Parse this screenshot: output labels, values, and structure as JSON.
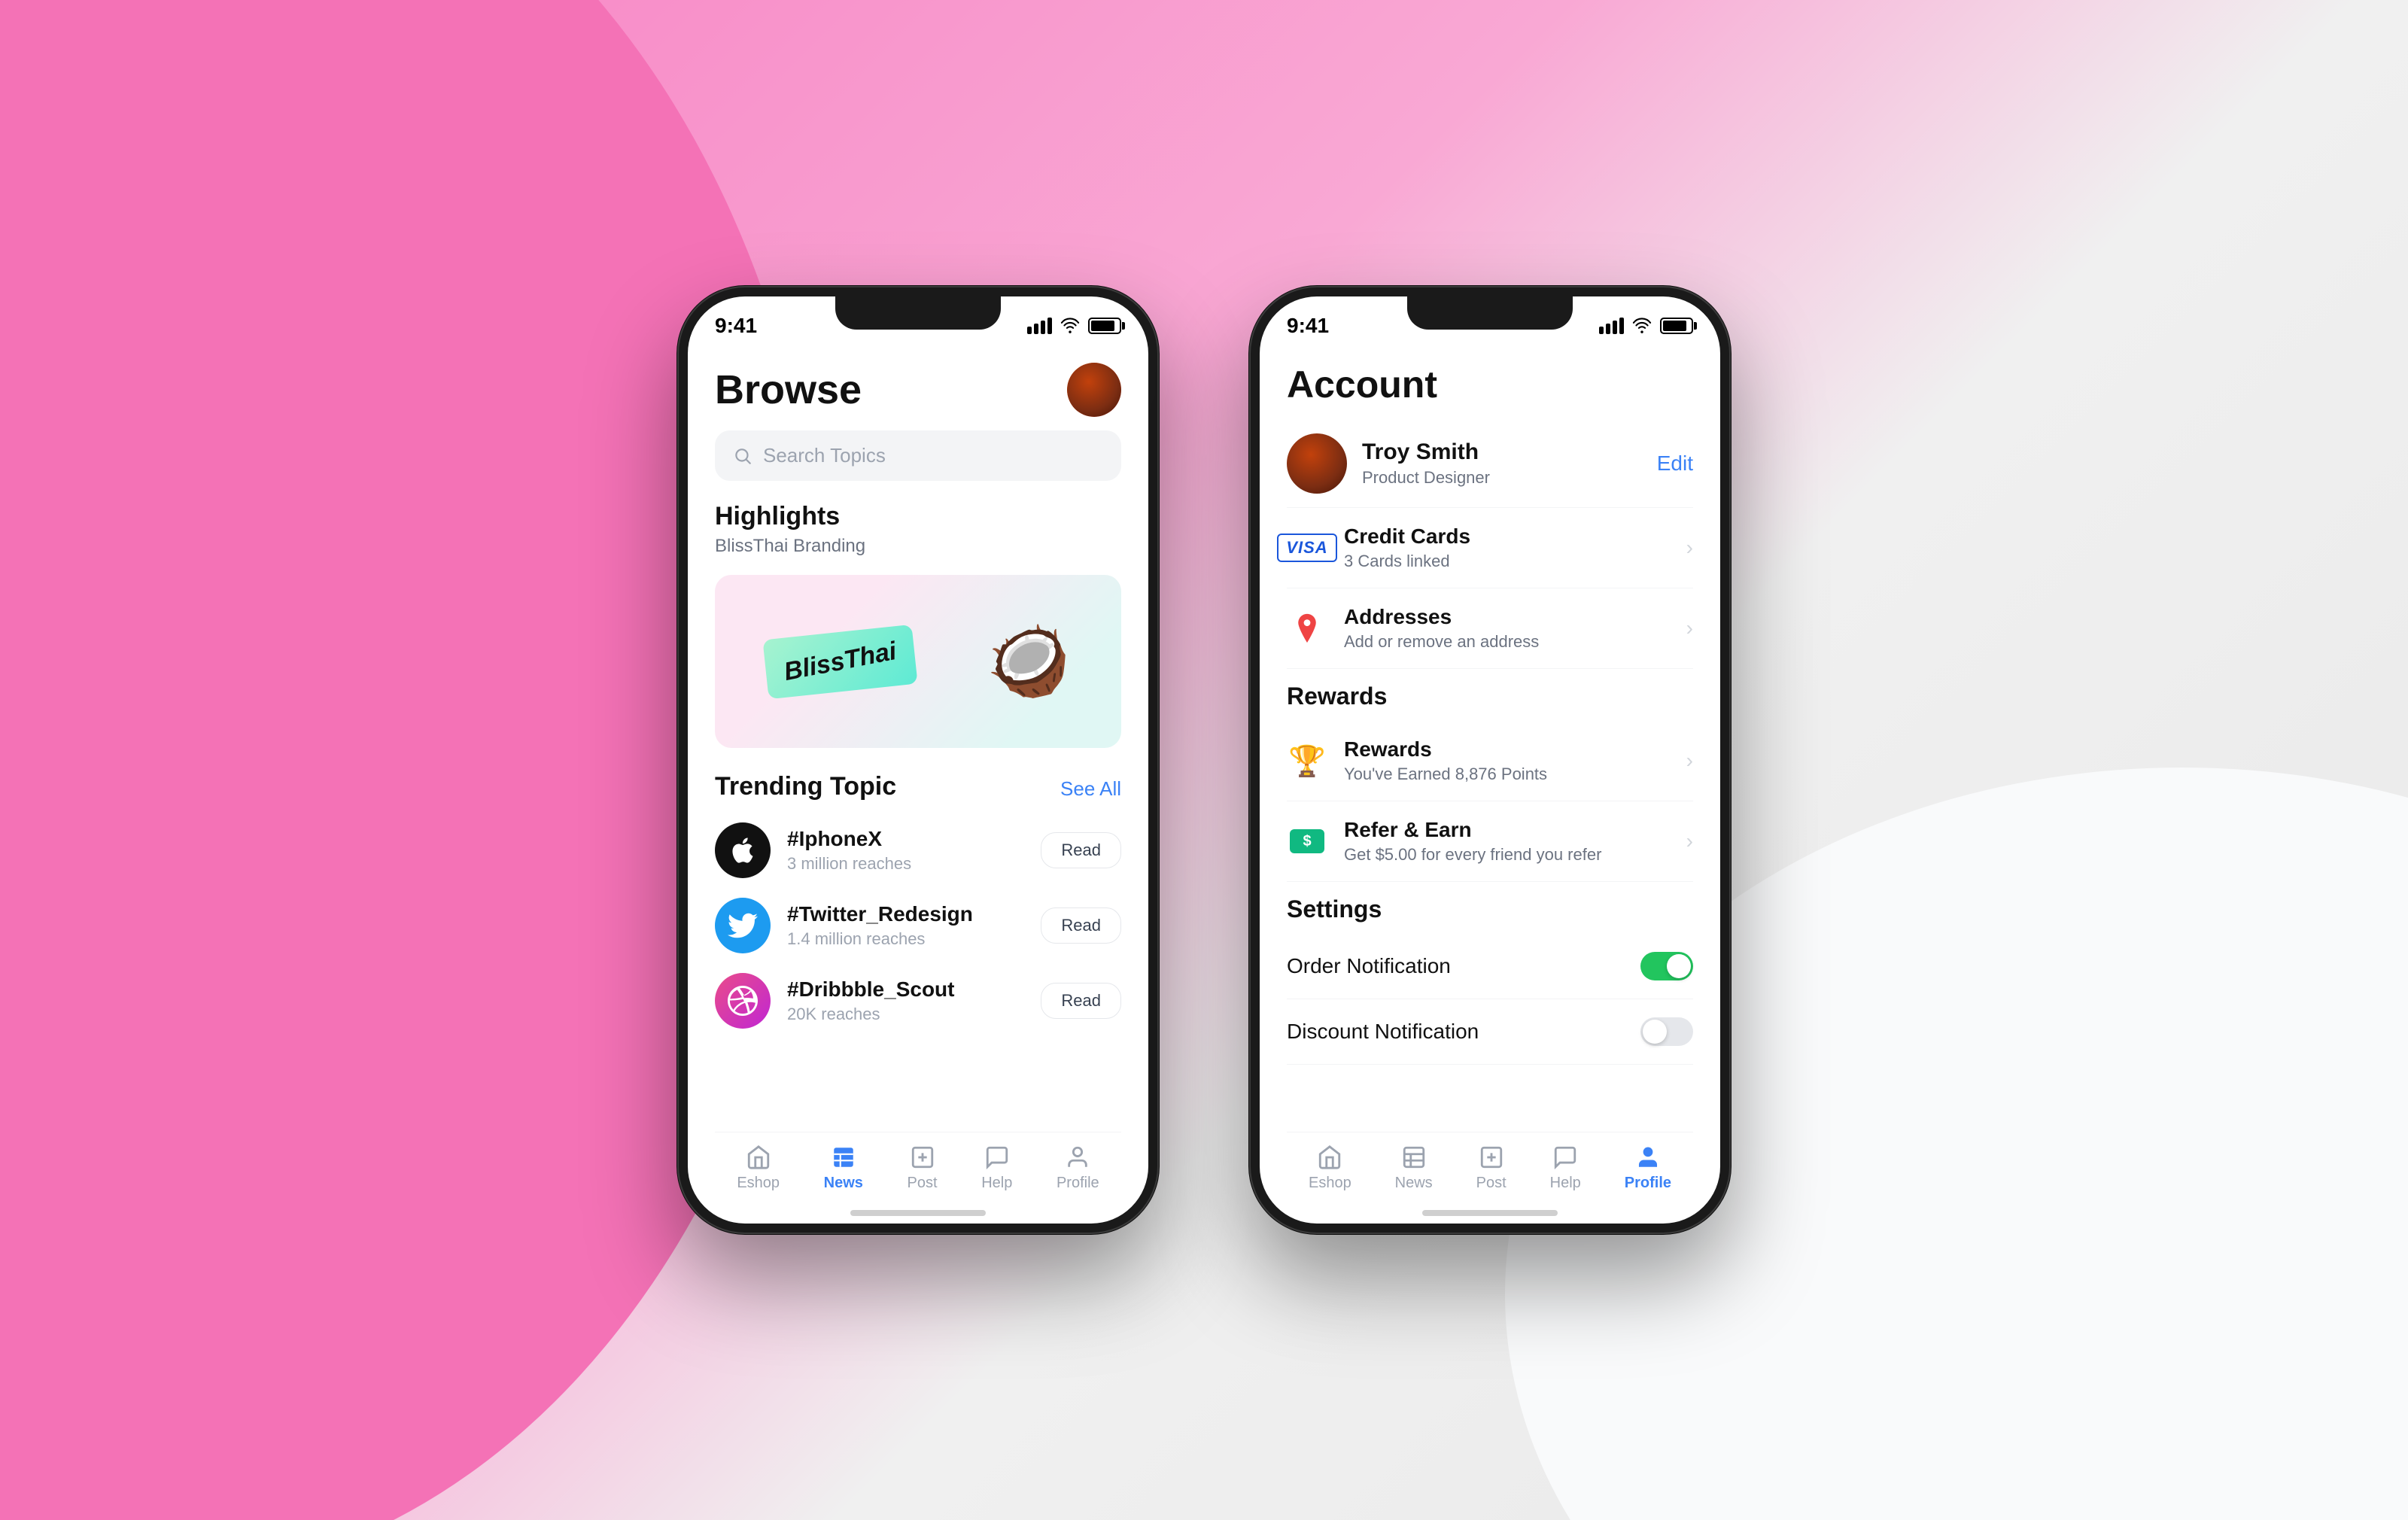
{
  "background": {
    "color_left": "#f472b6",
    "color_right": "#f9fafb"
  },
  "phone_browse": {
    "status_bar": {
      "time": "9:41",
      "signal": "●●●●",
      "wifi": "wifi",
      "battery": "battery"
    },
    "header": {
      "title": "Browse",
      "avatar_alt": "User avatar"
    },
    "search": {
      "placeholder": "Search Topics"
    },
    "highlights": {
      "section_title": "Highlights",
      "subtitle": "BlissThai Branding",
      "card_text": "BlissThai"
    },
    "trending": {
      "section_title": "Trending Topic",
      "see_all": "See All",
      "items": [
        {
          "id": "iphonex",
          "name": "#IphoneX",
          "reach": "3 million reaches",
          "icon": "apple",
          "read_btn": "Read"
        },
        {
          "id": "twitter",
          "name": "#Twitter_Redesign",
          "reach": "1.4 million reaches",
          "icon": "twitter",
          "read_btn": "Read"
        },
        {
          "id": "dribbble",
          "name": "#Dribbble_Scout",
          "reach": "20K reaches",
          "icon": "dribbble",
          "read_btn": "Read"
        }
      ]
    },
    "bottom_nav": {
      "items": [
        {
          "id": "eshop",
          "label": "Eshop",
          "icon": "🏠",
          "active": false
        },
        {
          "id": "news",
          "label": "News",
          "icon": "📰",
          "active": true
        },
        {
          "id": "post",
          "label": "Post",
          "icon": "📋",
          "active": false
        },
        {
          "id": "help",
          "label": "Help",
          "icon": "💬",
          "active": false
        },
        {
          "id": "profile",
          "label": "Profile",
          "icon": "👤",
          "active": false
        }
      ]
    }
  },
  "phone_account": {
    "status_bar": {
      "time": "9:41",
      "signal": "signal",
      "wifi": "wifi",
      "battery": "battery"
    },
    "header": {
      "title": "Account"
    },
    "profile": {
      "name": "Troy Smith",
      "role": "Product Designer",
      "edit_label": "Edit"
    },
    "account_section": {
      "items": [
        {
          "id": "credit_cards",
          "title": "Credit Cards",
          "subtitle": "3 Cards linked",
          "icon_type": "visa",
          "has_chevron": true
        },
        {
          "id": "addresses",
          "title": "Addresses",
          "subtitle": "Add or remove an address",
          "icon_type": "pin",
          "has_chevron": true
        }
      ]
    },
    "rewards_section": {
      "title": "Rewards",
      "items": [
        {
          "id": "rewards",
          "title": "Rewards",
          "subtitle": "You've Earned 8,876 Points",
          "icon_type": "trophy",
          "has_chevron": true
        },
        {
          "id": "refer",
          "title": "Refer & Earn",
          "subtitle": "Get $5.00 for every friend you refer",
          "icon_type": "money",
          "has_chevron": true
        }
      ]
    },
    "settings_section": {
      "title": "Settings",
      "toggles": [
        {
          "id": "order_notification",
          "label": "Order Notification",
          "enabled": true
        },
        {
          "id": "discount_notification",
          "label": "Discount Notification",
          "enabled": false
        }
      ]
    },
    "bottom_nav": {
      "items": [
        {
          "id": "eshop",
          "label": "Eshop",
          "icon": "🏠",
          "active": false
        },
        {
          "id": "news",
          "label": "News",
          "icon": "📰",
          "active": false
        },
        {
          "id": "post",
          "label": "Post",
          "icon": "📋",
          "active": false
        },
        {
          "id": "help",
          "label": "Help",
          "icon": "💬",
          "active": false
        },
        {
          "id": "profile",
          "label": "Profile",
          "icon": "👤",
          "active": true
        }
      ]
    }
  }
}
